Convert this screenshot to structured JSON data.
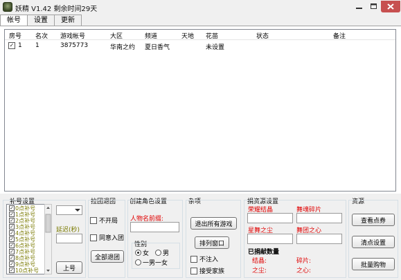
{
  "window": {
    "title": "妖精 V1.42  剩余时间29天"
  },
  "tabs": [
    "帐号",
    "设置",
    "更新"
  ],
  "table": {
    "columns": [
      "房号",
      "名次",
      "游戏帐号",
      "大区",
      "频道",
      "天地",
      "花苗",
      "状态",
      "备注"
    ],
    "rows": [
      {
        "checked": true,
        "room": "1",
        "rank": "1",
        "account": "3875773",
        "region": "华南之约",
        "channel": "夏日香气",
        "tiandi": "",
        "huamiao": "未设置",
        "status": "",
        "note": ""
      }
    ]
  },
  "bu_hao": {
    "title": "补号设置",
    "items": [
      "0点补号",
      "1点补号",
      "2点补号",
      "3点补号",
      "4点补号",
      "5点补号",
      "6点补号",
      "7点补号",
      "8点补号",
      "9点补号",
      "10点补号"
    ],
    "delay_label": "延迟(秒)",
    "up_button": "上号"
  },
  "la_tuan": {
    "title": "拉团退团",
    "no_open": "不开局",
    "agree_join": "同意入团",
    "all_quit": "全部退团"
  },
  "create_role": {
    "title": "创建角色设置",
    "prefix_label": "人物名前缀:",
    "gender_label": "性别",
    "female": "女",
    "male": "男",
    "one_each": "一男一女"
  },
  "misc": {
    "title": "杂项",
    "quit_all": "退出所有游戏",
    "arrange": "排列窗口",
    "no_inject": "不注入",
    "accept_family": "接受家族"
  },
  "donate": {
    "title": "捐资源设置",
    "glory_crystal": "荣耀结晶",
    "dance_soul": "舞魂碎片",
    "star_dust": "星舞之尘",
    "dance_heart": "舞团之心",
    "donated_title": "已捐献数量",
    "crystal": "结晶:",
    "fragment": "碎片:",
    "dust": "之尘:",
    "heart": "之心:"
  },
  "resource": {
    "title": "资源",
    "view_coupons": "查看点券",
    "clear_points": "清点设置",
    "batch_buy": "批量购物"
  }
}
